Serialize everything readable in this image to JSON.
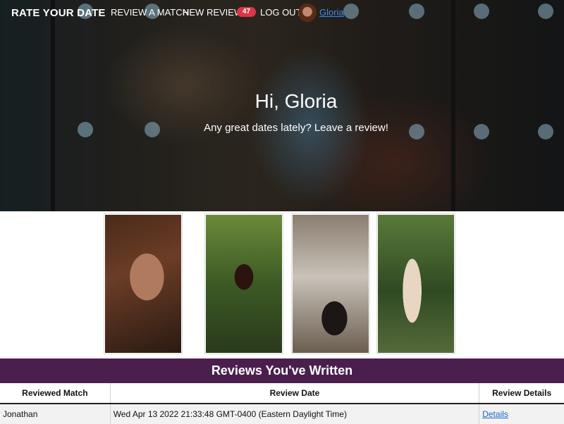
{
  "nav": {
    "brand": "RATE YOUR DATE",
    "review_match": "REVIEW A MATCH",
    "new_reviews": "NEW REVIEWS",
    "new_reviews_count": "47",
    "logout": "LOG OUT",
    "user_name": "Gloria"
  },
  "hero": {
    "title": "Hi, Gloria",
    "subtitle": "Any great dates lately? Leave a review!"
  },
  "gallery": {
    "photos": [
      "portrait-photo",
      "garden-photo",
      "ruins-photo",
      "forest-photo"
    ]
  },
  "reviews": {
    "heading": "Reviews You've Written",
    "columns": [
      "Reviewed Match",
      "Review Date",
      "Review Details"
    ],
    "rows": [
      {
        "match": "Jonathan",
        "date": "Wed Apr 13 2022 21:33:48 GMT-0400 (Eastern Daylight Time)",
        "details": "Details"
      }
    ]
  },
  "colors": {
    "accent": "#4a1f4e",
    "badge": "#dc3545",
    "link": "#1b64c8"
  }
}
